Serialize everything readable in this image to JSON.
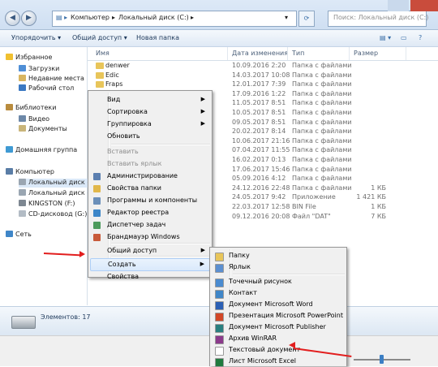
{
  "address": {
    "crumbs": [
      "Компьютер",
      "Локальный диск (C:)"
    ],
    "search_placeholder": "Поиск: Локальный диск (C:)"
  },
  "toolbar": {
    "organize": "Упорядочить ▾",
    "share": "Общий доступ ▾",
    "new_folder": "Новая папка"
  },
  "nav": {
    "favorites": "Избранное",
    "downloads": "Загрузки",
    "recent": "Недавние места",
    "desktop": "Рабочий стол",
    "libraries": "Библиотеки",
    "video": "Видео",
    "documents": "Документы",
    "homegroup": "Домашняя группа",
    "computer": "Компьютер",
    "local_disk": "Локальный диск (С",
    "local_disk2": "Локальный диск (D",
    "kingston": "KINGSTON (F:)",
    "cd": "CD-дисковод (G:)",
    "network": "Сеть"
  },
  "columns": {
    "name": "Имя",
    "date": "Дата изменения",
    "type": "Тип",
    "size": "Размер"
  },
  "files": [
    {
      "name": "denwer",
      "date": "10.09.2016 2:20",
      "type": "Папка с файлами",
      "size": ""
    },
    {
      "name": "Edic",
      "date": "14.03.2017 10:08",
      "type": "Папка с файлами",
      "size": ""
    },
    {
      "name": "Fraps",
      "date": "12.01.2017 7:39",
      "type": "Папка с файлами",
      "size": ""
    },
    {
      "name": "",
      "date": "17.09.2016 1:22",
      "type": "Папка с файлами",
      "size": ""
    },
    {
      "name": "",
      "date": "11.05.2017 8:51",
      "type": "Папка с файлами",
      "size": ""
    },
    {
      "name": "",
      "date": "10.05.2017 8:51",
      "type": "Папка с файлами",
      "size": ""
    },
    {
      "name": "",
      "date": "09.05.2017 8:51",
      "type": "Папка с файлами",
      "size": ""
    },
    {
      "name": "",
      "date": "20.02.2017 8:14",
      "type": "Папка с файлами",
      "size": ""
    },
    {
      "name": "",
      "date": "10.06.2017 21:16",
      "type": "Папка с файлами",
      "size": ""
    },
    {
      "name": "",
      "date": "07.04.2017 11:55",
      "type": "Папка с файлами",
      "size": ""
    },
    {
      "name": "",
      "date": "16.02.2017 0:13",
      "type": "Папка с файлами",
      "size": ""
    },
    {
      "name": "",
      "date": "17.06.2017 15:46",
      "type": "Папка с файлами",
      "size": ""
    },
    {
      "name": "",
      "date": "05.09.2016 4:12",
      "type": "Папка с файлами",
      "size": ""
    },
    {
      "name": "",
      "date": "24.12.2016 22:48",
      "type": "Папка с файлами",
      "size": "1 КБ"
    },
    {
      "name": "",
      "date": "24.05.2017 9:42",
      "type": "Приложение",
      "size": "1 421 КБ"
    },
    {
      "name": "",
      "date": "22.03.2017 12:58",
      "type": "BIN File",
      "size": "1 КБ"
    },
    {
      "name": "",
      "date": "09.12.2016 20:08",
      "type": "Файл \"DAT\"",
      "size": "7 КБ"
    }
  ],
  "status": {
    "items": "Элементов: 17"
  },
  "context_menu": {
    "items": [
      {
        "label": "Вид",
        "submenu": true
      },
      {
        "label": "Сортировка",
        "submenu": true
      },
      {
        "label": "Группировка",
        "submenu": true
      },
      {
        "label": "Обновить"
      },
      {
        "label": "Вставить",
        "disabled": true
      },
      {
        "label": "Вставить ярлык",
        "disabled": true
      },
      {
        "label": "Администрирование"
      },
      {
        "label": "Свойства папки"
      },
      {
        "label": "Программы и компоненты"
      },
      {
        "label": "Редактор реестра"
      },
      {
        "label": "Диспетчер задач"
      },
      {
        "label": "Брандмауэр Windows"
      },
      {
        "label": "Общий доступ",
        "submenu": true
      },
      {
        "label": "Создать",
        "submenu": true,
        "highlighted": true
      },
      {
        "label": "Свойства"
      }
    ]
  },
  "create_menu": {
    "items": [
      {
        "label": "Папку"
      },
      {
        "label": "Ярлык"
      },
      {
        "label": "Точечный рисунок"
      },
      {
        "label": "Контакт"
      },
      {
        "label": "Документ Microsoft Word"
      },
      {
        "label": "Презентация Microsoft PowerPoint"
      },
      {
        "label": "Документ Microsoft Publisher"
      },
      {
        "label": "Архив WinRAR"
      },
      {
        "label": "Текстовый документ"
      },
      {
        "label": "Лист Microsoft Excel"
      }
    ]
  },
  "colors": {
    "highlight_border": "#aecff7",
    "annotation_arrow": "#e21e1e",
    "folder": "#e8c55a"
  }
}
